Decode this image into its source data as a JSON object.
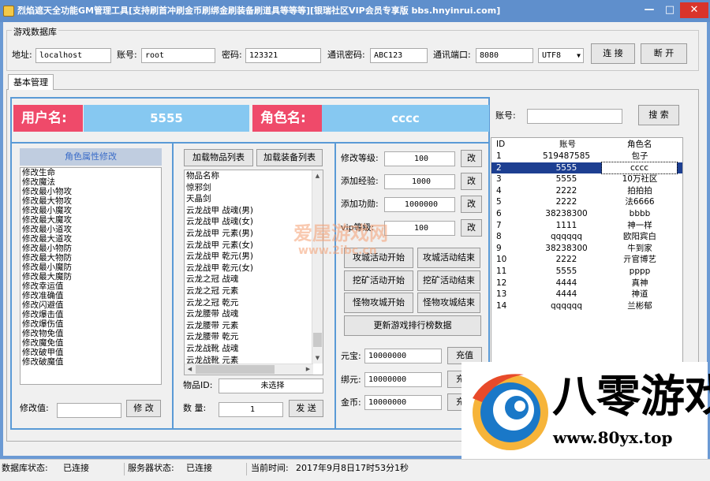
{
  "window": {
    "title": "烈焰遮天全功能GM管理工具[支持刷首冲刷金币刷绑金刷装备刷道具等等等][银瑞社区VIP会员专享版 bbs.hnyinrui.com]",
    "min": "—",
    "max": "□",
    "close": "✕"
  },
  "db": {
    "legend": "游戏数据库",
    "addr_label": "地址:",
    "addr": "localhost",
    "user_label": "账号:",
    "user": "root",
    "pass_label": "密码:",
    "pass": "123321",
    "comm_pass_label": "通讯密码:",
    "comm_pass": "ABC123",
    "port_label": "通讯端口:",
    "port": "8080",
    "encoding": "UTF8",
    "connect": "连 接",
    "disconnect": "断 开"
  },
  "tabs": [
    "基本管理"
  ],
  "header": {
    "user_label": "用户名:",
    "user_value": "5555",
    "role_label": "角色名:",
    "role_value": "cccc"
  },
  "attr": {
    "title": "角色属性修改",
    "items": [
      "修改生命",
      "修改魔法",
      "修改最小物攻",
      "修改最大物攻",
      "修改最小魔攻",
      "修改最大魔攻",
      "修改最小道攻",
      "修改最大道攻",
      "修改最小物防",
      "修改最大物防",
      "修改最小魔防",
      "修改最大魔防",
      "修改幸运值",
      "修改准确值",
      "修改闪避值",
      "修改爆击值",
      "修改爆伤值",
      "修改物免值",
      "修改魔免值",
      "修改破甲值",
      "修改破魔值"
    ],
    "value_label": "修改值:",
    "value": "",
    "modify": "修 改"
  },
  "items": {
    "load_items": "加载物品列表",
    "load_equip": "加载装备列表",
    "list": [
      "物品名称",
      "惊邪剑",
      "天晶剑",
      "云龙战甲 战魂(男)",
      "云龙战甲 战魂(女)",
      "云龙战甲 元素(男)",
      "云龙战甲 元素(女)",
      "云龙战甲 乾元(男)",
      "云龙战甲 乾元(女)",
      "云龙之冠 战魂",
      "云龙之冠 元素",
      "云龙之冠 乾元",
      "云龙腰带 战魂",
      "云龙腰带 元素",
      "云龙腰带 乾元",
      "云龙战靴 战魂",
      "云龙战靴 元素"
    ],
    "id_label": "物品ID:",
    "id_value": "未选择",
    "qty_label": "数  量:",
    "qty": "1",
    "send": "发 送"
  },
  "ops": {
    "level_label": "修改等级:",
    "level": "100",
    "exp_label": "添加经验:",
    "exp": "1000",
    "merit_label": "添加功勋:",
    "merit": "1000000",
    "vip_label": "vip等级:",
    "vip": "100",
    "change": "改",
    "buttons": [
      [
        "攻城活动开始",
        "攻城活动结束"
      ],
      [
        "挖矿活动开始",
        "挖矿活动结束"
      ],
      [
        "怪物攻城开始",
        "怪物攻城结束"
      ]
    ],
    "rank": "更新游戏排行榜数据"
  },
  "currency": {
    "yuanbao_label": "元宝:",
    "yuanbao": "10000000",
    "bangyuan_label": "绑元:",
    "bangyuan": "10000000",
    "gold_label": "金币:",
    "gold": "10000000",
    "recharge": "充值"
  },
  "search": {
    "label": "账号:",
    "value": "",
    "button": "搜 索"
  },
  "table": {
    "columns": [
      "ID",
      "账号",
      "角色名"
    ],
    "rows": [
      [
        "1",
        "519487585",
        "包子"
      ],
      [
        "2",
        "5555",
        "cccc"
      ],
      [
        "3",
        "5555",
        "10万社区"
      ],
      [
        "4",
        "2222",
        "拍拍拍"
      ],
      [
        "5",
        "2222",
        "法6666"
      ],
      [
        "6",
        "38238300",
        "bbbb"
      ],
      [
        "7",
        "1111",
        "神一样"
      ],
      [
        "8",
        "qqqqqq",
        "欧阳宾白"
      ],
      [
        "9",
        "38238300",
        "牛到家"
      ],
      [
        "10",
        "2222",
        "亓官博艺"
      ],
      [
        "11",
        "5555",
        "pppp"
      ],
      [
        "12",
        "4444",
        "真神"
      ],
      [
        "13",
        "4444",
        "神道"
      ],
      [
        "14",
        "qqqqqq",
        "兰彬郁"
      ]
    ],
    "selected": 1
  },
  "status": {
    "db_label": "数据库状态:",
    "db_value": "已连接",
    "server_label": "服务器状态:",
    "server_value": "已连接",
    "time_label": "当前时间:",
    "time_value": "2017年9月8日17时53分1秒"
  },
  "watermark": {
    "line1": "爱屋游戏网",
    "line2": "www.2ibc.cn"
  },
  "logo": {
    "text": "八零游戏",
    "url": "www.80yx.top",
    "accent": "#1a78c8"
  },
  "colors": {
    "title_bar": "#5f8fcc",
    "pink": "#ef4a6a",
    "light_blue": "#86c8f1",
    "frame_blue": "#5a9ad6",
    "selected_row": "#1d3f91"
  }
}
